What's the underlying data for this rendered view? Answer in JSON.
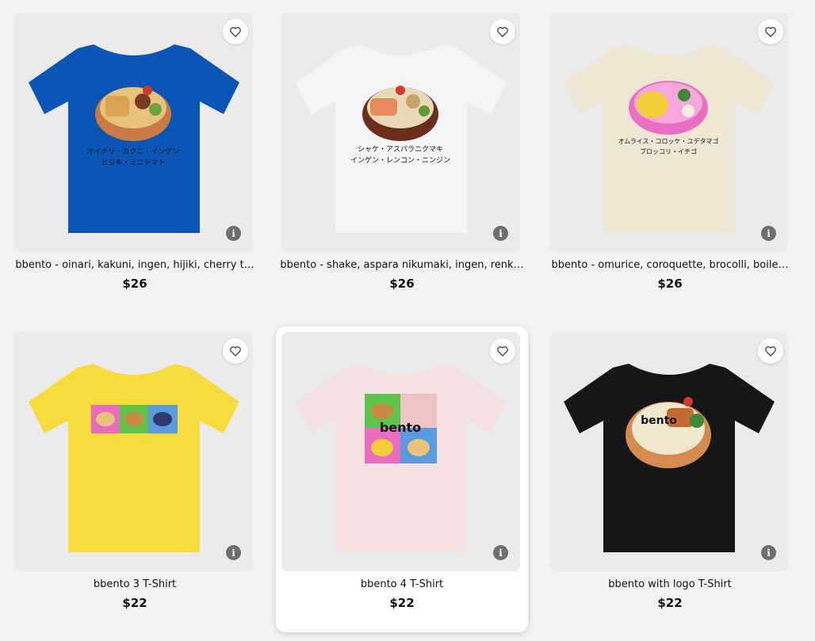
{
  "products": [
    {
      "title": "bbento - oinari, kakuni, ingen, hijiki, cherry t…",
      "price": "$26",
      "shirt_color": "#0a55b5",
      "print_lines": [
        "オイナリ・カクニ・インゲン",
        "ヒジキ・ミニトマト"
      ]
    },
    {
      "title": "bbento - shake, aspara nikumaki, ingen, renk…",
      "price": "$26",
      "shirt_color": "#f4f4f6",
      "print_lines": [
        "シャケ・アスパラニクマキ",
        "インゲン・レンコン・ニンジン"
      ]
    },
    {
      "title": "bbento - omurice, coroquette, brocolli, boile…",
      "price": "$26",
      "shirt_color": "#efe6d3",
      "print_lines": [
        "オムライス・コロッケ・ユデタマゴ",
        "ブロッコリ・イチゴ"
      ]
    },
    {
      "title": "bbento 3 T-Shirt",
      "price": "$22",
      "shirt_color": "#f7dc3d",
      "print_lines": []
    },
    {
      "title": "bbento 4 T-Shirt",
      "price": "$22",
      "shirt_color": "#f5e1e1",
      "print_lines": []
    },
    {
      "title": "bbento with logo T-Shirt",
      "price": "$22",
      "shirt_color": "#161616",
      "print_lines": []
    }
  ],
  "logo_text": "bento"
}
